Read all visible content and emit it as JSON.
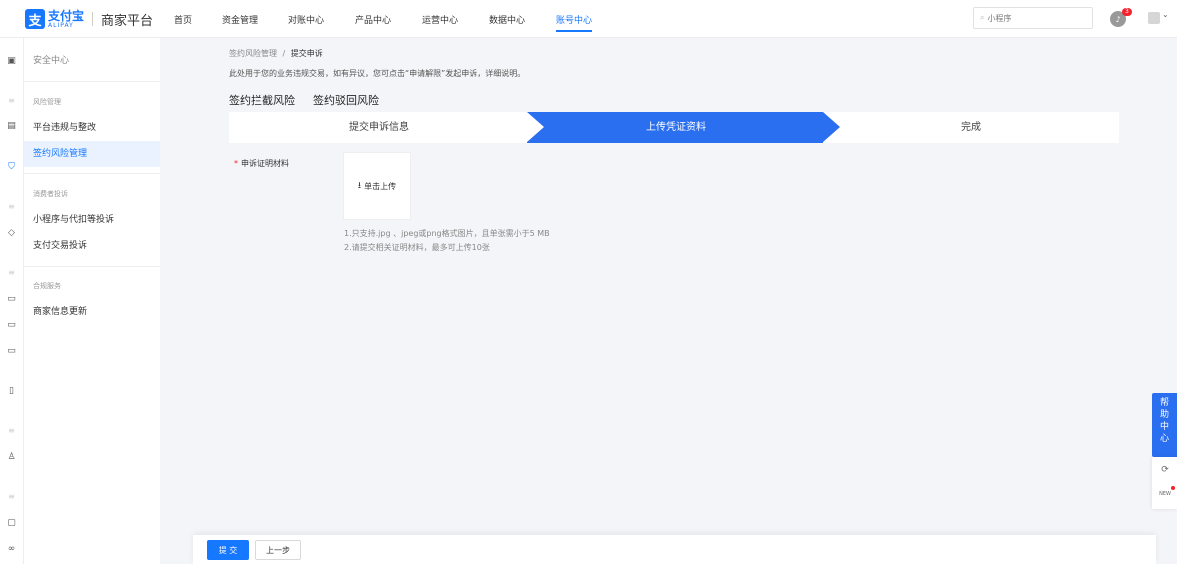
{
  "brand": {
    "mark": "支",
    "name_cn": "支付宝",
    "name_en": "ALIPAY",
    "platform": "商家平台"
  },
  "nav": {
    "items": [
      "首页",
      "资金管理",
      "对账中心",
      "产品中心",
      "运营中心",
      "数据中心",
      "账号中心"
    ],
    "active": "账号中心"
  },
  "search": {
    "placeholder": "小程序"
  },
  "notifications": {
    "count": "3"
  },
  "sidebar": {
    "top_item": "安全中心",
    "group1": "风险管理",
    "item_violation": "平台违规与整改",
    "item_contract_risk": "签约风险管理",
    "group2": "消费者投诉",
    "item_mini_complaint": "小程序与代扣等投诉",
    "item_pay_complaint": "支付交易投诉",
    "group3": "合规服务",
    "item_merchant_update": "商家信息更新"
  },
  "breadcrumb": {
    "parent": "签约风险管理",
    "separator": "/",
    "current": "提交申诉"
  },
  "description": "此处用于您的业务违规交易，如有异议，您可点击“申请解限”发起申诉，详细说明。",
  "tabs": [
    "签约拦截风险",
    "签约驳回风险"
  ],
  "steps": {
    "step1": "提交申诉信息",
    "step2": "上传凭证资料",
    "step3": "完成",
    "current": 2
  },
  "form": {
    "required_mark": "*",
    "label": "申诉证明材料",
    "upload_label": "单击上传",
    "hint1": "1.只支持.jpg 、jpeg或png格式图片，且单张需小于5 MB",
    "hint2": "2.请提交相关证明材料，最多可上传10张"
  },
  "footer": {
    "submit": "提 交",
    "prev": "上一步"
  },
  "help": {
    "chars": [
      "帮",
      "助",
      "中",
      "心"
    ],
    "new_label": "NEW"
  }
}
